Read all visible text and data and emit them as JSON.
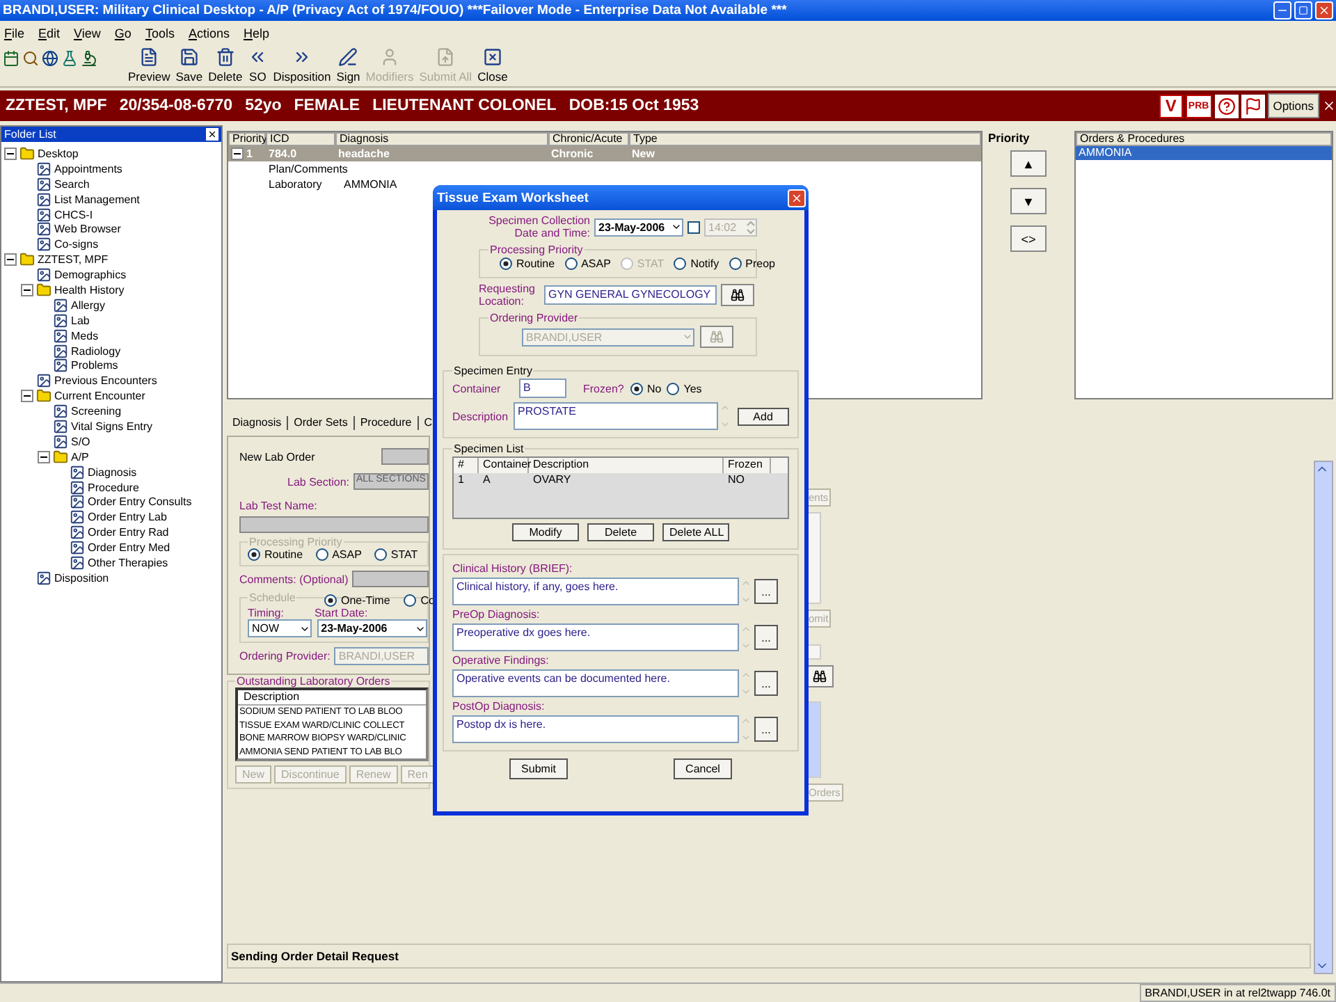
{
  "window": {
    "title": "BRANDI,USER: Military Clinical Desktop - A/P (Privacy Act of 1974/FOUO) ***Failover Mode - Enterprise Data Not Available ***"
  },
  "menu": [
    "File",
    "Edit",
    "View",
    "Go",
    "Tools",
    "Actions",
    "Help"
  ],
  "toolbar": [
    {
      "label": "Preview",
      "disabled": false
    },
    {
      "label": "Save",
      "disabled": false
    },
    {
      "label": "Delete",
      "disabled": false
    },
    {
      "label": "SO",
      "disabled": false
    },
    {
      "label": "Disposition",
      "disabled": false
    },
    {
      "label": "Sign",
      "disabled": false
    },
    {
      "label": "Modifiers",
      "disabled": true
    },
    {
      "label": "Submit All",
      "disabled": true
    },
    {
      "label": "Close",
      "disabled": false
    }
  ],
  "patient_bar": {
    "fields": [
      "ZZTEST, MPF",
      "20/354-08-6770",
      "52yo",
      "FEMALE",
      "LIEUTENANT COLONEL",
      "DOB:15 Oct 1953"
    ],
    "badges": [
      "V",
      "PRB"
    ],
    "options": "Options"
  },
  "folder_list": {
    "title": "Folder List",
    "tree": [
      {
        "label": "Desktop",
        "kind": "folder",
        "expanded": true,
        "children": [
          {
            "label": "Appointments",
            "kind": "module"
          },
          {
            "label": "Search",
            "kind": "module"
          },
          {
            "label": "List Management",
            "kind": "module"
          },
          {
            "label": "CHCS-I",
            "kind": "module"
          },
          {
            "label": "Web Browser",
            "kind": "module"
          },
          {
            "label": "Co-signs",
            "kind": "module"
          }
        ]
      },
      {
        "label": "ZZTEST, MPF",
        "kind": "folder",
        "expanded": true,
        "children": [
          {
            "label": "Demographics",
            "kind": "module"
          },
          {
            "label": "Health History",
            "kind": "folder",
            "expanded": true,
            "children": [
              {
                "label": "Allergy",
                "kind": "module"
              },
              {
                "label": "Lab",
                "kind": "module"
              },
              {
                "label": "Meds",
                "kind": "module"
              },
              {
                "label": "Radiology",
                "kind": "module"
              },
              {
                "label": "Problems",
                "kind": "module"
              }
            ]
          },
          {
            "label": "Previous Encounters",
            "kind": "module"
          },
          {
            "label": "Current Encounter",
            "kind": "folder",
            "expanded": true,
            "children": [
              {
                "label": "Screening",
                "kind": "module"
              },
              {
                "label": "Vital Signs Entry",
                "kind": "module"
              },
              {
                "label": "S/O",
                "kind": "module"
              },
              {
                "label": "A/P",
                "kind": "folder",
                "expanded": true,
                "children": [
                  {
                    "label": "Diagnosis",
                    "kind": "module"
                  },
                  {
                    "label": "Procedure",
                    "kind": "module"
                  },
                  {
                    "label": "Order Entry Consults",
                    "kind": "module"
                  },
                  {
                    "label": "Order Entry Lab",
                    "kind": "module"
                  },
                  {
                    "label": "Order Entry Rad",
                    "kind": "module"
                  },
                  {
                    "label": "Order Entry Med",
                    "kind": "module"
                  },
                  {
                    "label": "Other Therapies",
                    "kind": "module"
                  }
                ]
              }
            ]
          },
          {
            "label": "Disposition",
            "kind": "module"
          }
        ]
      }
    ]
  },
  "diagnosis_table": {
    "columns": [
      "Priority",
      "ICD",
      "Diagnosis",
      "Chronic/Acute",
      "Type"
    ],
    "rows": [
      {
        "cells": [
          "1",
          "784.0",
          "headache",
          "Chronic",
          "New"
        ],
        "selected": true,
        "expanded": true
      }
    ],
    "details": [
      [
        "Plan/Comments"
      ],
      [
        "Laboratory",
        "AMMONIA"
      ]
    ]
  },
  "priority": {
    "title": "Priority",
    "buttons": [
      "▲",
      "▼",
      "<>"
    ]
  },
  "orders": {
    "title": "Orders & Procedures",
    "items": [
      {
        "label": "AMMONIA",
        "selected": true
      }
    ]
  },
  "tabs": [
    {
      "label": "Diagnosis",
      "selected": false
    },
    {
      "label": "Order Sets",
      "selected": false
    },
    {
      "label": "Procedure",
      "selected": false
    },
    {
      "label": "C",
      "selected": false
    }
  ],
  "lab_order": {
    "title": "New Lab Order",
    "section_label": "Lab Section:",
    "section": "ALL SECTIONS",
    "test_label": "Lab Test Name:",
    "priority": {
      "legend": "Processing Priority",
      "options": [
        {
          "label": "Routine",
          "selected": true
        },
        {
          "label": "ASAP",
          "selected": false
        },
        {
          "label": "STAT",
          "selected": false
        }
      ]
    },
    "comments_label": "Comments: (Optional)",
    "schedule": {
      "legend": "Schedule",
      "options": [
        {
          "label": "One-Time",
          "selected": true
        },
        {
          "label": "Co",
          "selected": false
        }
      ],
      "timing_label": "Timing:",
      "timing": "NOW",
      "start_label": "Start Date:",
      "start_date": "23-May-2006"
    },
    "provider_label": "Ordering Provider:",
    "provider": "BRANDI,USER",
    "outstanding": {
      "legend": "Outstanding Laboratory Orders",
      "column": "Description",
      "rows": [
        "SODIUM  SEND PATIENT TO LAB  BLOO",
        "TISSUE EXAM  WARD/CLINIC COLLECT",
        "BONE MARROW BIOPSY  WARD/CLINIC",
        "AMMONIA  SEND PATIENT TO LAB  BLO"
      ],
      "buttons": [
        "New",
        "Discontinue",
        "Renew",
        "Ren"
      ]
    },
    "right_fragments": [
      "ents",
      "omit",
      "Orders"
    ]
  },
  "status_message": "Sending Order Detail Request",
  "status_bar": "BRANDI,USER in  at rel2twapp 746.0t",
  "dialog": {
    "title": "Tissue Exam Worksheet",
    "collection": {
      "label": "Specimen Collection Date and Time:",
      "date": "23-May-2006",
      "time_checked": false,
      "time": "14:02"
    },
    "priority": {
      "legend": "Processing Priority",
      "options": [
        {
          "label": "Routine",
          "selected": true,
          "disabled": false
        },
        {
          "label": "ASAP",
          "selected": false,
          "disabled": false
        },
        {
          "label": "STAT",
          "selected": false,
          "disabled": true
        },
        {
          "label": "Notify",
          "selected": false,
          "disabled": false
        },
        {
          "label": "Preop",
          "selected": false,
          "disabled": false
        }
      ]
    },
    "location": {
      "label": "Requesting Location:",
      "value": "GYN GENERAL GYNECOLOGY"
    },
    "provider": {
      "legend": "Ordering Provider",
      "value": "BRANDI,USER",
      "disabled": true
    },
    "entry": {
      "legend": "Specimen Entry",
      "container_label": "Container",
      "container": "B",
      "frozen_label": "Frozen?",
      "frozen": [
        {
          "label": "No",
          "selected": true
        },
        {
          "label": "Yes",
          "selected": false
        }
      ],
      "description_label": "Description",
      "description": "PROSTATE",
      "add": "Add"
    },
    "specimens": {
      "legend": "Specimen List",
      "columns": [
        "#",
        "Container",
        "Description",
        "Frozen"
      ],
      "rows": [
        [
          "1",
          "A",
          "OVARY",
          "NO"
        ]
      ],
      "buttons": [
        "Modify",
        "Delete",
        "Delete ALL"
      ]
    },
    "notes": [
      {
        "label": "Clinical History (BRIEF):",
        "value": "Clinical history, if any, goes here.",
        "more": "..."
      },
      {
        "label": "PreOp Diagnosis:",
        "value": "Preoperative dx goes here.",
        "more": "..."
      },
      {
        "label": "Operative Findings:",
        "value": "Operative events can be documented here.",
        "more": "..."
      },
      {
        "label": "PostOp Diagnosis:",
        "value": "Postop dx is here.",
        "more": "..."
      }
    ],
    "buttons": [
      "Submit",
      "Cancel"
    ]
  }
}
